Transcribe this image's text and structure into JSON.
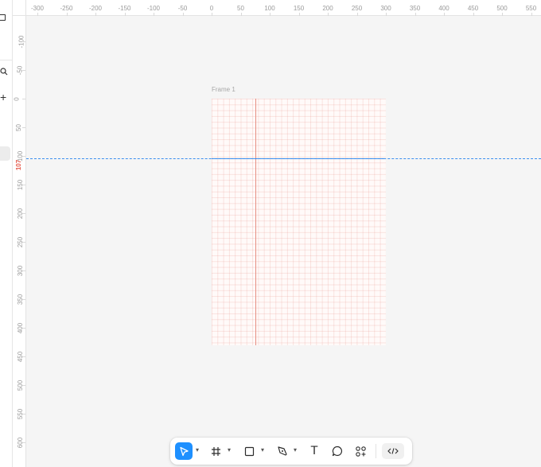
{
  "canvas": {
    "frame_name": "Frame 1",
    "guide_y_value": "107",
    "ruler_top_labels": [
      "-300",
      "-250",
      "-200",
      "-150",
      "-100",
      "-50",
      "0",
      "50",
      "100",
      "150",
      "200",
      "250",
      "300",
      "350",
      "400",
      "450",
      "500",
      "550"
    ],
    "ruler_left_labels": [
      "-100",
      "-50",
      "0",
      "50",
      "100",
      "150",
      "200",
      "250",
      "300",
      "350",
      "400",
      "450",
      "500",
      "550",
      "600"
    ]
  },
  "toolbar": {
    "tools": [
      {
        "name": "move-tool",
        "icon": "cursor-icon",
        "active": true
      },
      {
        "name": "frame-tool",
        "icon": "hash-icon"
      },
      {
        "name": "shape-tool",
        "icon": "square-icon"
      },
      {
        "name": "pen-tool",
        "icon": "pen-icon"
      },
      {
        "name": "text-tool",
        "icon": "text-icon",
        "glyph": "T"
      },
      {
        "name": "comment-tool",
        "icon": "comment-icon"
      },
      {
        "name": "resources-tool",
        "icon": "components-icon"
      },
      {
        "name": "dev-mode",
        "icon": "code-icon"
      }
    ]
  },
  "colors": {
    "accent": "#1e90ff",
    "guide": "#3b8ff0",
    "frame_line": "#e68f83"
  }
}
